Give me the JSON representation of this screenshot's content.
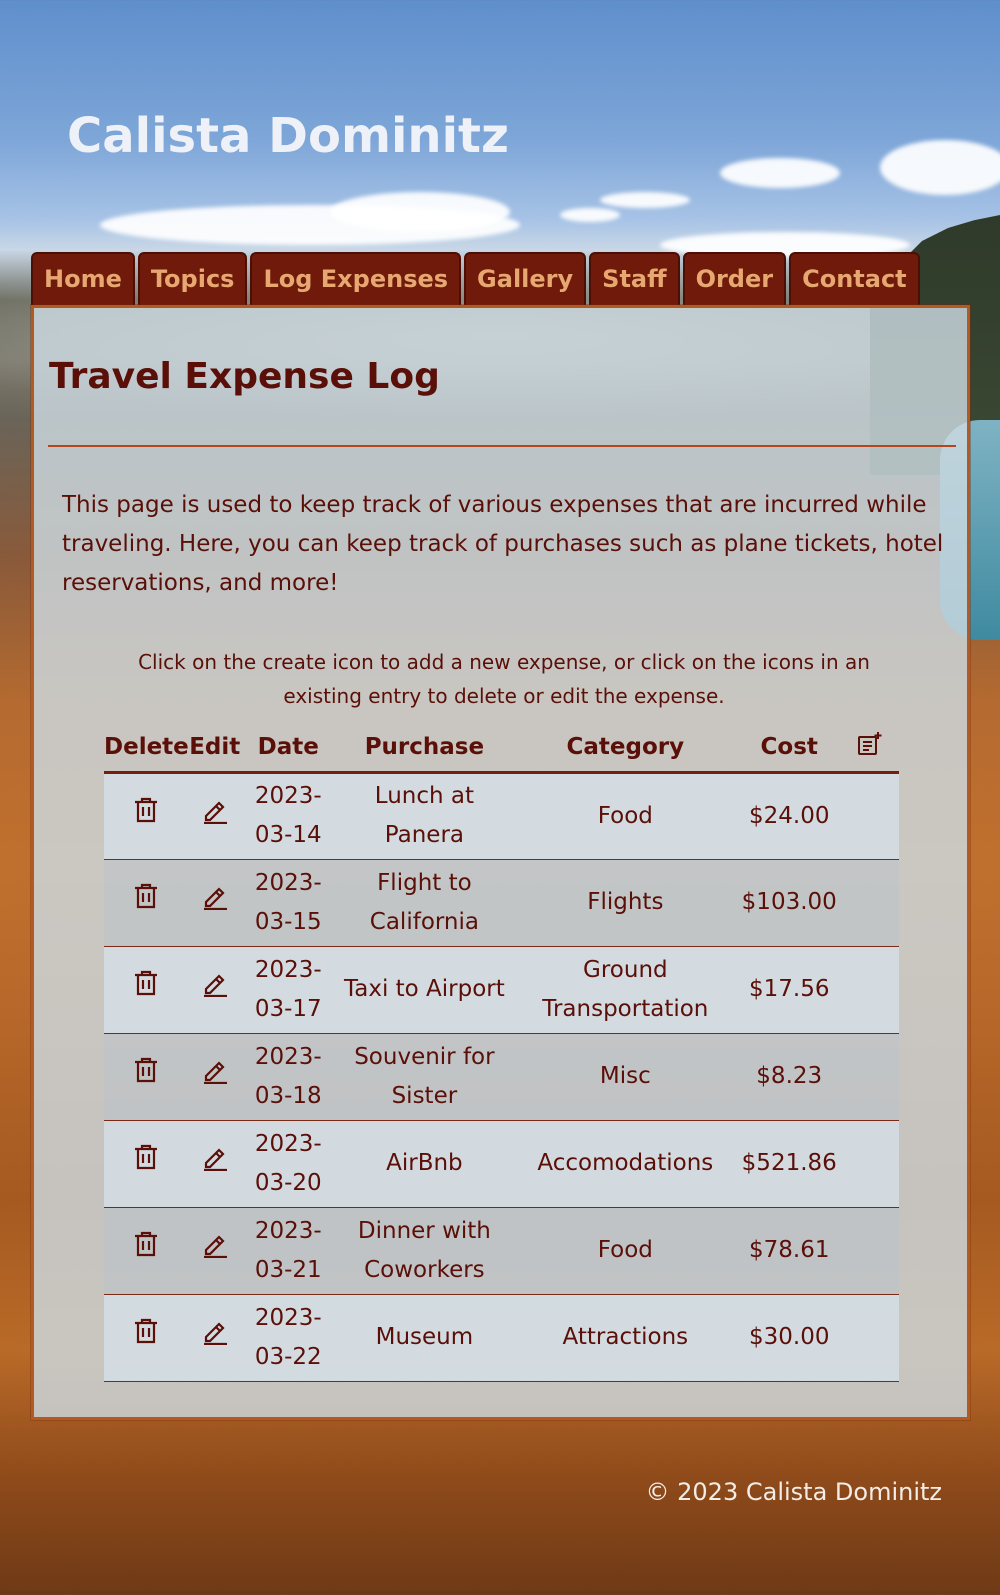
{
  "site": {
    "title": "Calista Dominitz"
  },
  "nav": {
    "items": [
      {
        "label": "Home"
      },
      {
        "label": "Topics"
      },
      {
        "label": "Log Expenses"
      },
      {
        "label": "Gallery"
      },
      {
        "label": "Staff"
      },
      {
        "label": "Order"
      },
      {
        "label": "Contact"
      }
    ]
  },
  "main": {
    "title": "Travel Expense Log",
    "intro": "This page is used to keep track of various expenses that are incurred while traveling. Here, you can keep track of purchases such as plane tickets, hotel reservations, and more!",
    "instructions": "Click on the create icon to add a new expense, or click on the icons in an existing entry to delete or edit the expense."
  },
  "table": {
    "headers": {
      "delete": "Delete",
      "edit": "Edit",
      "date": "Date",
      "purchase": "Purchase",
      "category": "Category",
      "cost": "Cost"
    },
    "icons": {
      "create": "create-note-icon",
      "delete": "trash-icon",
      "edit": "pencil-icon"
    },
    "rows": [
      {
        "date": "2023-03-14",
        "purchase": "Lunch at Panera",
        "category": "Food",
        "cost": "$24.00"
      },
      {
        "date": "2023-03-15",
        "purchase": "Flight to California",
        "category": "Flights",
        "cost": "$103.00"
      },
      {
        "date": "2023-03-17",
        "purchase": "Taxi to Airport",
        "category": "Ground Transportation",
        "cost": "$17.56"
      },
      {
        "date": "2023-03-18",
        "purchase": "Souvenir for Sister",
        "category": "Misc",
        "cost": "$8.23"
      },
      {
        "date": "2023-03-20",
        "purchase": "AirBnb",
        "category": "Accomodations",
        "cost": "$521.86"
      },
      {
        "date": "2023-03-21",
        "purchase": "Dinner with Coworkers",
        "category": "Food",
        "cost": "$78.61"
      },
      {
        "date": "2023-03-22",
        "purchase": "Museum",
        "category": "Attractions",
        "cost": "$30.00"
      }
    ]
  },
  "footer": {
    "text": "© 2023 Calista Dominitz"
  },
  "colors": {
    "accent": "#5a0f08",
    "nav_bg": "#6f1a0a",
    "nav_text": "#e7a771",
    "border": "#b35a22"
  }
}
